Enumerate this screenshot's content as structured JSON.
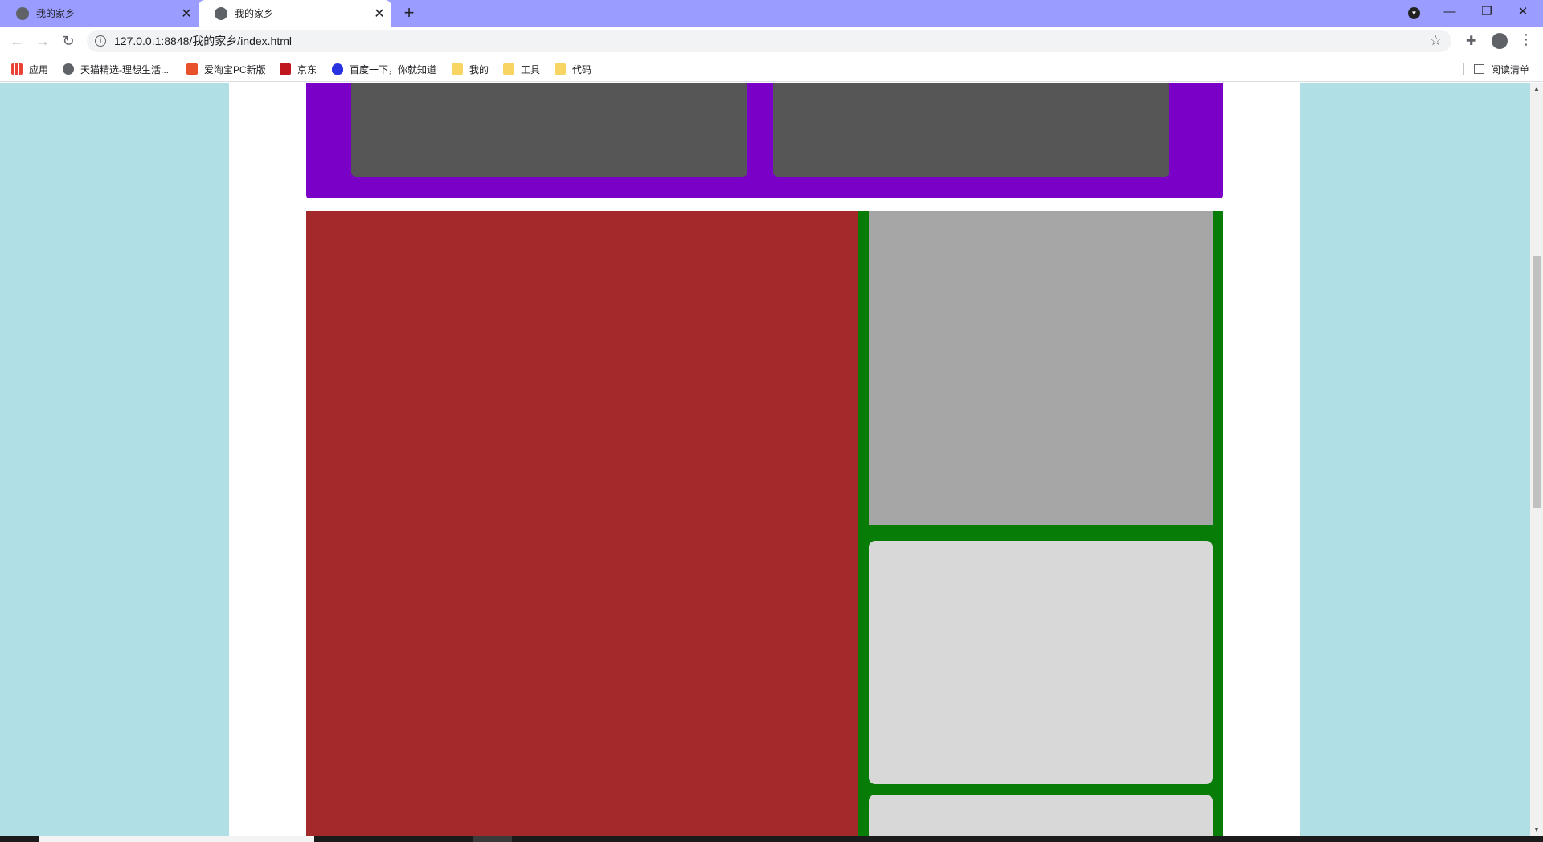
{
  "browser": {
    "tabs": [
      {
        "title": "我的家乡",
        "active": false,
        "icon": "globe-icon"
      },
      {
        "title": "我的家乡",
        "active": true,
        "icon": "globe-icon"
      }
    ],
    "close_glyph": "✕",
    "new_tab_glyph": "+",
    "window_controls": {
      "minimize": "—",
      "restore": "❐",
      "close": "✕"
    },
    "address": "127.0.0.1:8848/我的家乡/index.html",
    "bookmarks": [
      {
        "label": "应用",
        "icon": "apps-grid-icon"
      },
      {
        "label": "天猫精选-理想生活...",
        "icon": "globe-icon"
      },
      {
        "label": "爱淘宝PC新版",
        "icon": "taobao-icon"
      },
      {
        "label": "京东",
        "icon": "jd-icon"
      },
      {
        "label": "百度一下，你就知道",
        "icon": "baidu-paw-icon"
      },
      {
        "label": "我的",
        "icon": "folder-icon"
      },
      {
        "label": "工具",
        "icon": "folder-icon"
      },
      {
        "label": "代码",
        "icon": "folder-icon"
      }
    ],
    "reading_list": "阅读清单"
  },
  "page": {
    "colors": {
      "background": "#b0e0e6",
      "container": "#ffffff",
      "purple_band": "#7b00c7",
      "dark_card": "#565656",
      "red_block": "#a3292a",
      "green_column": "#077d07",
      "gray_panel": "#a6a6a6",
      "light_card": "#d8d8d8"
    }
  }
}
